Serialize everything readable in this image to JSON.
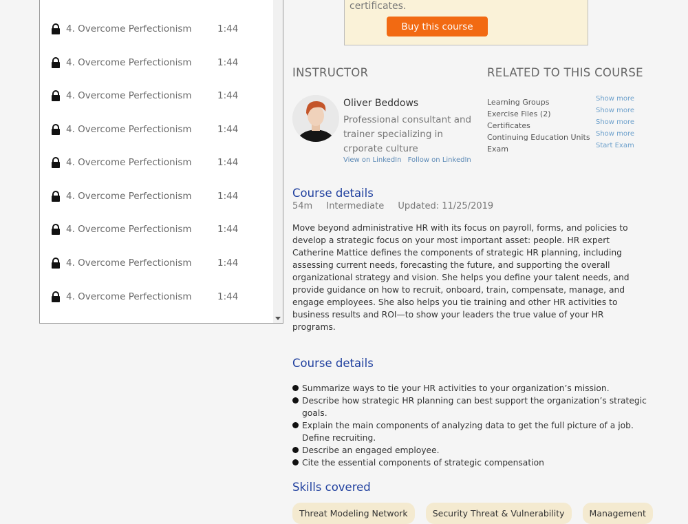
{
  "playlist": {
    "lessons": [
      {
        "title": "4. Overcome Perfectionism",
        "duration": "1:44"
      },
      {
        "title": "4. Overcome Perfectionism",
        "duration": "1:44"
      },
      {
        "title": "4. Overcome Perfectionism",
        "duration": "1:44"
      },
      {
        "title": "4. Overcome Perfectionism",
        "duration": "1:44"
      },
      {
        "title": "4. Overcome Perfectionism",
        "duration": "1:44"
      },
      {
        "title": "4. Overcome Perfectionism",
        "duration": "1:44"
      },
      {
        "title": "4. Overcome Perfectionism",
        "duration": "1:44"
      },
      {
        "title": "4. Overcome Perfectionism",
        "duration": "1:44"
      },
      {
        "title": "4. Overcome Perfectionism",
        "duration": "1:44"
      }
    ]
  },
  "buy_box": {
    "text": "certificates.",
    "button_label": "Buy this course"
  },
  "instructor": {
    "heading": "INSTRUCTOR",
    "name": "Oliver Beddows",
    "description": "Professional consultant and trainer specializing in crporate culture",
    "link_linkedin": "View on LinkedIn",
    "link_follow": "Follow on LinkedIn"
  },
  "related": {
    "heading": "RELATED TO THIS COURSE",
    "items": [
      {
        "label": "Learning Groups",
        "action": "Show more"
      },
      {
        "label": "Exercise Files (2)",
        "action": "Show more"
      },
      {
        "label": "Certificates",
        "action": "Show more"
      },
      {
        "label": "Continuing Education Units",
        "action": "Show more"
      },
      {
        "label": "Exam",
        "action": "Start Exam"
      }
    ]
  },
  "course_details": {
    "title": "Course details",
    "duration": "54m",
    "level": "Intermediate",
    "updated": "Updated: 11/25/2019",
    "description": "Move beyond administrative HR with its focus on payroll, forms, and policies to develop a strategic focus on your most important asset: people. HR expert Catherine Mattice defines the components of strategic HR planning, including assessing current needs, forecasting the future, and supporting the overall organizational strategy and vision. She helps you define your talent needs, and provide guidance on how to recruit, onboard, train, compensate, manage, and engage employees. She also helps you tie training and other HR activities to business results and ROI—to show your leaders the true value of your HR programs."
  },
  "objectives": {
    "title": "Course details",
    "items": [
      "Summarize ways to tie your HR activities to your organization’s mission.",
      "Describe how strategic HR planning can best support the organization’s strategic goals.",
      "Explain the main components of analyzing data to get the full picture of a job. Define recruiting.",
      "Describe an engaged employee.",
      "Cite the essential components of strategic compensation"
    ]
  },
  "skills": {
    "title": "Skills covered",
    "items": [
      "Threat Modeling Network",
      "Security Threat & Vulnerability",
      "Management"
    ]
  },
  "colors": {
    "accent_orange": "#f26a12",
    "heading_blue": "#1f3f9e",
    "link_blue": "#5a88b5"
  }
}
